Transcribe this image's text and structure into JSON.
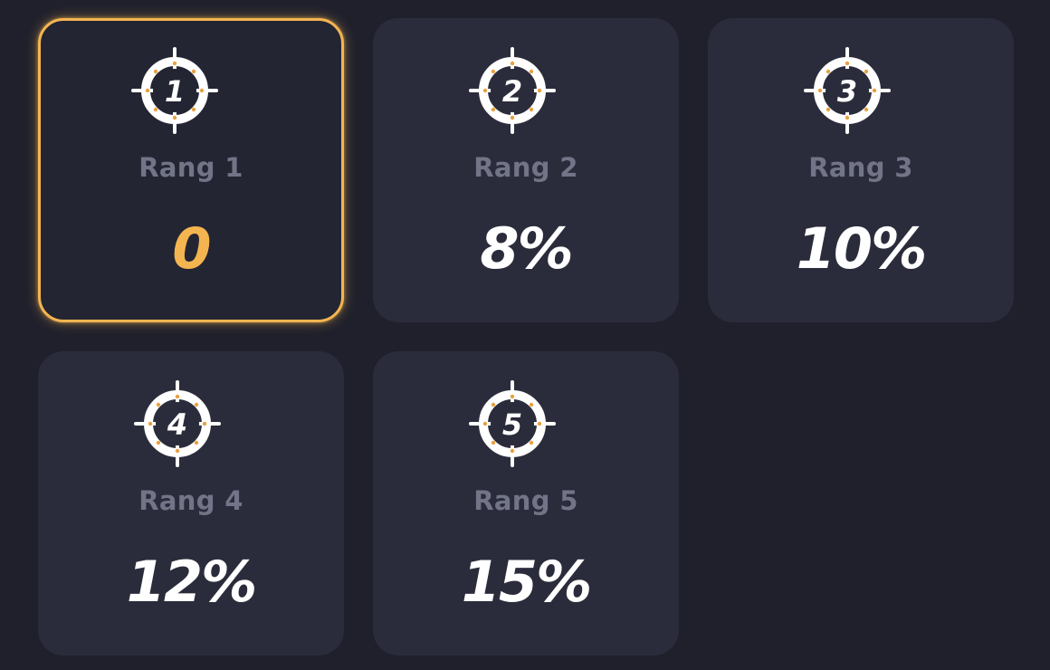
{
  "colors": {
    "background": "#1f202c",
    "card": "#2b2c3b",
    "selected_border": "#f4b550",
    "label": "#727487",
    "value": "#ffffff",
    "selected_value": "#f4b550",
    "icon_dots": "#e8a040"
  },
  "ranks": [
    {
      "label": "Rang 1",
      "number": "1",
      "value": "0",
      "selected": true,
      "icon": "crosshair-rank-icon"
    },
    {
      "label": "Rang 2",
      "number": "2",
      "value": "8%",
      "selected": false,
      "icon": "crosshair-rank-icon"
    },
    {
      "label": "Rang 3",
      "number": "3",
      "value": "10%",
      "selected": false,
      "icon": "crosshair-rank-icon"
    },
    {
      "label": "Rang 4",
      "number": "4",
      "value": "12%",
      "selected": false,
      "icon": "crosshair-rank-icon"
    },
    {
      "label": "Rang 5",
      "number": "5",
      "value": "15%",
      "selected": false,
      "icon": "crosshair-rank-icon"
    }
  ]
}
